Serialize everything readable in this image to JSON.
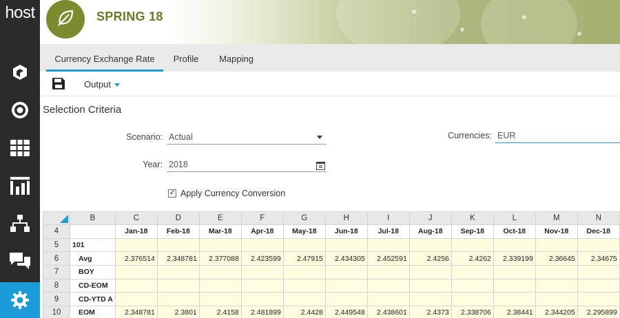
{
  "brand": {
    "rail_logo": "host",
    "app_title": "SPRING 18"
  },
  "rail": {
    "items": [
      {
        "icon": "cube-icon"
      },
      {
        "icon": "target-icon"
      },
      {
        "icon": "grid-icon"
      },
      {
        "icon": "chart-icon"
      },
      {
        "icon": "hierarchy-icon"
      },
      {
        "icon": "chat-icon"
      },
      {
        "icon": "gear-icon",
        "active": true
      }
    ]
  },
  "tabs": [
    {
      "label": "Currency Exchange Rate",
      "active": true
    },
    {
      "label": "Profile",
      "active": false
    },
    {
      "label": "Mapping",
      "active": false
    }
  ],
  "toolbar": {
    "save_icon": "save-icon",
    "output_label": "Output"
  },
  "selection": {
    "title": "Selection Criteria",
    "scenario_label": "Scenario:",
    "scenario_value": "Actual",
    "year_label": "Year:",
    "year_value": "2018",
    "currencies_label": "Currencies:",
    "currencies_value": "EUR",
    "apply_label": "Apply Currency Conversion",
    "apply_checked": true,
    "check_mark": "✓"
  },
  "sheet": {
    "columns": [
      "B",
      "C",
      "D",
      "E",
      "F",
      "G",
      "H",
      "I",
      "J",
      "K",
      "L",
      "M",
      "N"
    ],
    "rows": [
      {
        "num": "4",
        "cells": [
          "",
          "Jan-18",
          "Feb-18",
          "Mar-18",
          "Apr-18",
          "May-18",
          "Jun-18",
          "Jul-18",
          "Aug-18",
          "Sep-18",
          "Oct-18",
          "Nov-18",
          "Dec-18"
        ]
      },
      {
        "num": "5",
        "cells": [
          "101",
          "",
          "",
          "",
          "",
          "",
          "",
          "",
          "",
          "",
          "",
          "",
          ""
        ]
      },
      {
        "num": "6",
        "cells": [
          "Avg",
          "2.376514",
          "2.348781",
          "2.377088",
          "2.423599",
          "2.47915",
          "2.434305",
          "2.452591",
          "2.4256",
          "2.4262",
          "2.339199",
          "2.36645",
          "2.34675"
        ]
      },
      {
        "num": "7",
        "cells": [
          "BOY",
          "",
          "",
          "",
          "",
          "",
          "",
          "",
          "",
          "",
          "",
          "",
          ""
        ]
      },
      {
        "num": "8",
        "cells": [
          "CD-EOM",
          "",
          "",
          "",
          "",
          "",
          "",
          "",
          "",
          "",
          "",
          "",
          ""
        ]
      },
      {
        "num": "9",
        "cells": [
          "CD-YTD A",
          "",
          "",
          "",
          "",
          "",
          "",
          "",
          "",
          "",
          "",
          "",
          ""
        ]
      },
      {
        "num": "10",
        "cells": [
          "EOM",
          "2.348781",
          "2.3801",
          "2.4158",
          "2.481899",
          "2.4428",
          "2.449548",
          "2.438601",
          "2.4373",
          "2.338706",
          "2.38441",
          "2.344205",
          "2.295899"
        ]
      }
    ]
  },
  "colors": {
    "accent": "#1b9bd7",
    "brand": "#7c8b2e",
    "rail": "#2b2b2b",
    "input_cell": "#fdfde0"
  }
}
